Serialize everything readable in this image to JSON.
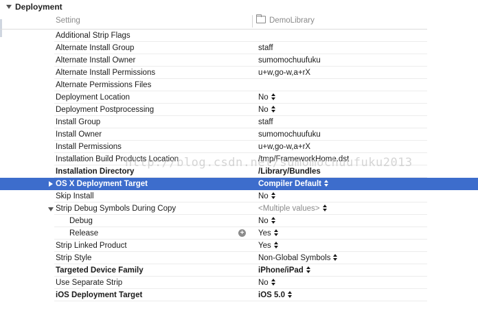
{
  "section": {
    "title": "Deployment"
  },
  "columns": {
    "setting": "Setting",
    "target": "DemoLibrary"
  },
  "rows": [
    {
      "name": "Additional Strip Flags",
      "value": ""
    },
    {
      "name": "Alternate Install Group",
      "value": "staff"
    },
    {
      "name": "Alternate Install Owner",
      "value": "sumomochuufuku"
    },
    {
      "name": "Alternate Install Permissions",
      "value": "u+w,go-w,a+rX"
    },
    {
      "name": "Alternate Permissions Files",
      "value": ""
    },
    {
      "name": "Deployment Location",
      "value": "No"
    },
    {
      "name": "Deployment Postprocessing",
      "value": "No"
    },
    {
      "name": "Install Group",
      "value": "staff"
    },
    {
      "name": "Install Owner",
      "value": "sumomochuufuku"
    },
    {
      "name": "Install Permissions",
      "value": "u+w,go-w,a+rX"
    },
    {
      "name": "Installation Build Products Location",
      "value": "/tmp/FrameworkHome.dst"
    },
    {
      "name": "Installation Directory",
      "value": "/Library/Bundles"
    },
    {
      "name": "OS X Deployment Target",
      "value": "Compiler Default"
    },
    {
      "name": "Skip Install",
      "value": "No"
    },
    {
      "name": "Strip Debug Symbols During Copy",
      "value": "<Multiple values>"
    },
    {
      "name": "Debug",
      "value": "No"
    },
    {
      "name": "Release",
      "value": "Yes"
    },
    {
      "name": "Strip Linked Product",
      "value": "Yes"
    },
    {
      "name": "Strip Style",
      "value": "Non-Global Symbols"
    },
    {
      "name": "Targeted Device Family",
      "value": "iPhone/iPad"
    },
    {
      "name": "Use Separate Strip",
      "value": "No"
    },
    {
      "name": "iOS Deployment Target",
      "value": "iOS 5.0"
    }
  ],
  "watermark": "http://blog.csdn.net/sumomochuufuku2013",
  "colors": {
    "selection": "#3d6dcc",
    "text": "#1a1a1a",
    "muted": "#8a8a8a"
  },
  "icons": {
    "disclosure": "disclosure-triangle-icon",
    "stepper": "stepper-arrows-icon",
    "folder": "folder-icon",
    "add": "plus-circle-icon"
  }
}
